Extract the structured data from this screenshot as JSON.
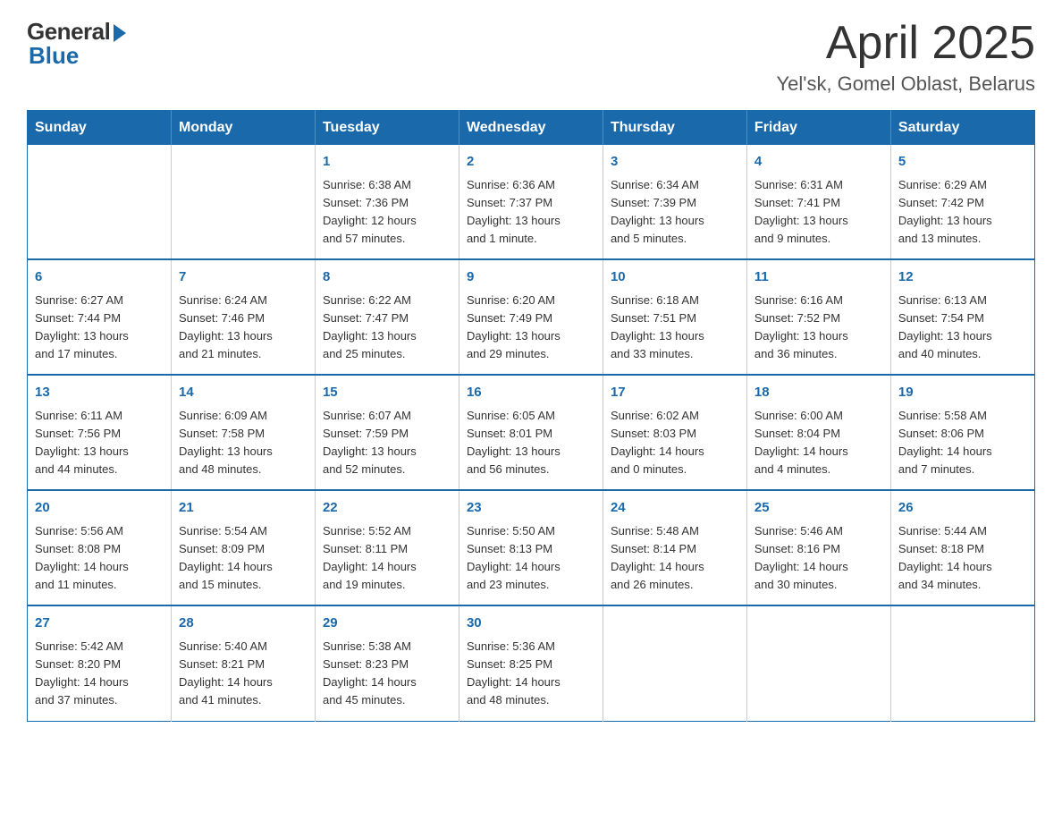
{
  "header": {
    "logo": {
      "general": "General",
      "blue": "Blue"
    },
    "title": "April 2025",
    "subtitle": "Yel'sk, Gomel Oblast, Belarus"
  },
  "weekdays": [
    "Sunday",
    "Monday",
    "Tuesday",
    "Wednesday",
    "Thursday",
    "Friday",
    "Saturday"
  ],
  "weeks": [
    [
      {
        "day": "",
        "info": ""
      },
      {
        "day": "",
        "info": ""
      },
      {
        "day": "1",
        "info": "Sunrise: 6:38 AM\nSunset: 7:36 PM\nDaylight: 12 hours\nand 57 minutes."
      },
      {
        "day": "2",
        "info": "Sunrise: 6:36 AM\nSunset: 7:37 PM\nDaylight: 13 hours\nand 1 minute."
      },
      {
        "day": "3",
        "info": "Sunrise: 6:34 AM\nSunset: 7:39 PM\nDaylight: 13 hours\nand 5 minutes."
      },
      {
        "day": "4",
        "info": "Sunrise: 6:31 AM\nSunset: 7:41 PM\nDaylight: 13 hours\nand 9 minutes."
      },
      {
        "day": "5",
        "info": "Sunrise: 6:29 AM\nSunset: 7:42 PM\nDaylight: 13 hours\nand 13 minutes."
      }
    ],
    [
      {
        "day": "6",
        "info": "Sunrise: 6:27 AM\nSunset: 7:44 PM\nDaylight: 13 hours\nand 17 minutes."
      },
      {
        "day": "7",
        "info": "Sunrise: 6:24 AM\nSunset: 7:46 PM\nDaylight: 13 hours\nand 21 minutes."
      },
      {
        "day": "8",
        "info": "Sunrise: 6:22 AM\nSunset: 7:47 PM\nDaylight: 13 hours\nand 25 minutes."
      },
      {
        "day": "9",
        "info": "Sunrise: 6:20 AM\nSunset: 7:49 PM\nDaylight: 13 hours\nand 29 minutes."
      },
      {
        "day": "10",
        "info": "Sunrise: 6:18 AM\nSunset: 7:51 PM\nDaylight: 13 hours\nand 33 minutes."
      },
      {
        "day": "11",
        "info": "Sunrise: 6:16 AM\nSunset: 7:52 PM\nDaylight: 13 hours\nand 36 minutes."
      },
      {
        "day": "12",
        "info": "Sunrise: 6:13 AM\nSunset: 7:54 PM\nDaylight: 13 hours\nand 40 minutes."
      }
    ],
    [
      {
        "day": "13",
        "info": "Sunrise: 6:11 AM\nSunset: 7:56 PM\nDaylight: 13 hours\nand 44 minutes."
      },
      {
        "day": "14",
        "info": "Sunrise: 6:09 AM\nSunset: 7:58 PM\nDaylight: 13 hours\nand 48 minutes."
      },
      {
        "day": "15",
        "info": "Sunrise: 6:07 AM\nSunset: 7:59 PM\nDaylight: 13 hours\nand 52 minutes."
      },
      {
        "day": "16",
        "info": "Sunrise: 6:05 AM\nSunset: 8:01 PM\nDaylight: 13 hours\nand 56 minutes."
      },
      {
        "day": "17",
        "info": "Sunrise: 6:02 AM\nSunset: 8:03 PM\nDaylight: 14 hours\nand 0 minutes."
      },
      {
        "day": "18",
        "info": "Sunrise: 6:00 AM\nSunset: 8:04 PM\nDaylight: 14 hours\nand 4 minutes."
      },
      {
        "day": "19",
        "info": "Sunrise: 5:58 AM\nSunset: 8:06 PM\nDaylight: 14 hours\nand 7 minutes."
      }
    ],
    [
      {
        "day": "20",
        "info": "Sunrise: 5:56 AM\nSunset: 8:08 PM\nDaylight: 14 hours\nand 11 minutes."
      },
      {
        "day": "21",
        "info": "Sunrise: 5:54 AM\nSunset: 8:09 PM\nDaylight: 14 hours\nand 15 minutes."
      },
      {
        "day": "22",
        "info": "Sunrise: 5:52 AM\nSunset: 8:11 PM\nDaylight: 14 hours\nand 19 minutes."
      },
      {
        "day": "23",
        "info": "Sunrise: 5:50 AM\nSunset: 8:13 PM\nDaylight: 14 hours\nand 23 minutes."
      },
      {
        "day": "24",
        "info": "Sunrise: 5:48 AM\nSunset: 8:14 PM\nDaylight: 14 hours\nand 26 minutes."
      },
      {
        "day": "25",
        "info": "Sunrise: 5:46 AM\nSunset: 8:16 PM\nDaylight: 14 hours\nand 30 minutes."
      },
      {
        "day": "26",
        "info": "Sunrise: 5:44 AM\nSunset: 8:18 PM\nDaylight: 14 hours\nand 34 minutes."
      }
    ],
    [
      {
        "day": "27",
        "info": "Sunrise: 5:42 AM\nSunset: 8:20 PM\nDaylight: 14 hours\nand 37 minutes."
      },
      {
        "day": "28",
        "info": "Sunrise: 5:40 AM\nSunset: 8:21 PM\nDaylight: 14 hours\nand 41 minutes."
      },
      {
        "day": "29",
        "info": "Sunrise: 5:38 AM\nSunset: 8:23 PM\nDaylight: 14 hours\nand 45 minutes."
      },
      {
        "day": "30",
        "info": "Sunrise: 5:36 AM\nSunset: 8:25 PM\nDaylight: 14 hours\nand 48 minutes."
      },
      {
        "day": "",
        "info": ""
      },
      {
        "day": "",
        "info": ""
      },
      {
        "day": "",
        "info": ""
      }
    ]
  ]
}
